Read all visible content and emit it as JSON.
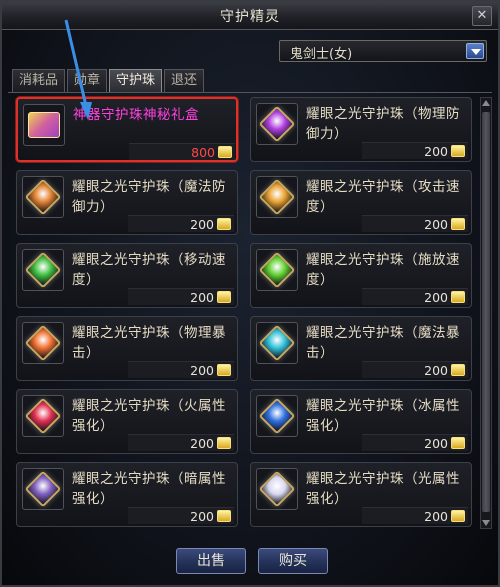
{
  "window": {
    "title": "守护精灵",
    "close_icon": "close-icon"
  },
  "character_select": {
    "value": "鬼剑士(女)",
    "icon": "chevron-down-icon"
  },
  "tabs": [
    {
      "label": "消耗品",
      "active": false
    },
    {
      "label": "勋章",
      "active": false
    },
    {
      "label": "守护珠",
      "active": true
    },
    {
      "label": "退还",
      "active": false
    }
  ],
  "items": [
    {
      "name": "神器守护珠神秘礼盒",
      "price": "800",
      "icon": "gift-box-icon",
      "selected": true,
      "name_color": "#ff40e0"
    },
    {
      "name": "耀眼之光守护珠（物理防御力）",
      "price": "200",
      "icon": "purple-gem-icon",
      "gem_color": "#b040e0"
    },
    {
      "name": "耀眼之光守护珠（魔法防御力）",
      "price": "200",
      "icon": "orange-gem-icon",
      "gem_color": "#e08030"
    },
    {
      "name": "耀眼之光守护珠（攻击速度）",
      "price": "200",
      "icon": "orange-gem-icon",
      "gem_color": "#e8a030"
    },
    {
      "name": "耀眼之光守护珠（移动速度）",
      "price": "200",
      "icon": "green-gem-icon",
      "gem_color": "#40c040"
    },
    {
      "name": "耀眼之光守护珠（施放速度）",
      "price": "200",
      "icon": "green-gem-icon",
      "gem_color": "#60d030"
    },
    {
      "name": "耀眼之光守护珠（物理暴击）",
      "price": "200",
      "icon": "orange-gem-icon",
      "gem_color": "#f07030"
    },
    {
      "name": "耀眼之光守护珠（魔法暴击）",
      "price": "200",
      "icon": "cyan-gem-icon",
      "gem_color": "#30c0d8"
    },
    {
      "name": "耀眼之光守护珠（火属性强化）",
      "price": "200",
      "icon": "red-gem-icon",
      "gem_color": "#e03050"
    },
    {
      "name": "耀眼之光守护珠（冰属性强化）",
      "price": "200",
      "icon": "blue-gem-icon",
      "gem_color": "#3070e0"
    },
    {
      "name": "耀眼之光守护珠（暗属性强化）",
      "price": "200",
      "icon": "violet-gem-icon",
      "gem_color": "#8060c0"
    },
    {
      "name": "耀眼之光守护珠（光属性强化）",
      "price": "200",
      "icon": "white-gem-icon",
      "gem_color": "#d8d8f0"
    }
  ],
  "currency_icon": "gold-coin-icon",
  "buttons": {
    "sell": "出售",
    "buy": "购买"
  },
  "colors": {
    "selected_border": "#e0302a",
    "price_selected": "#ff4848",
    "annotation_arrow": "#3a8ee8"
  }
}
